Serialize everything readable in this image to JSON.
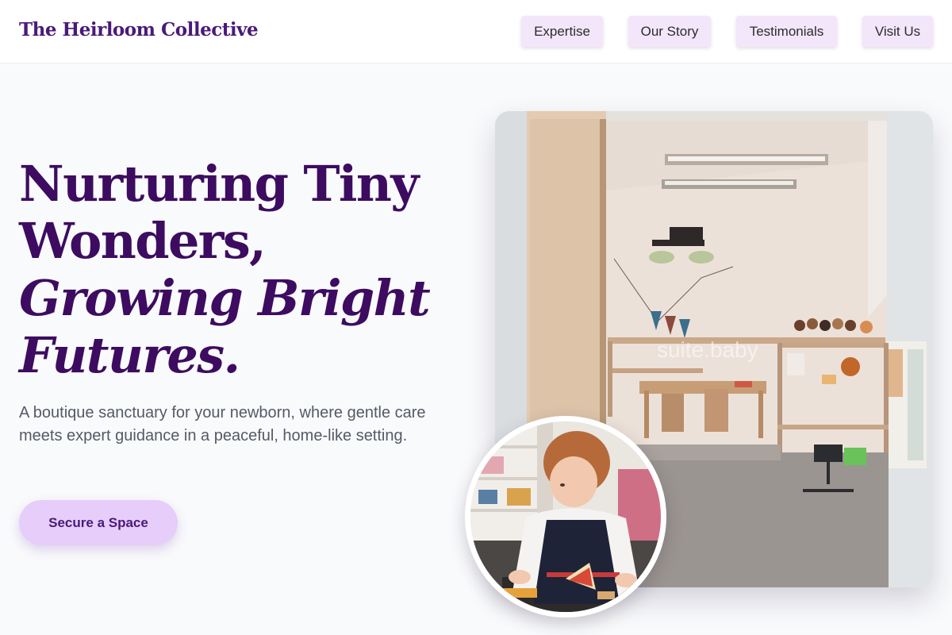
{
  "header": {
    "brand": "The Heirloom Collective",
    "nav": [
      {
        "label": "Expertise"
      },
      {
        "label": "Our Story"
      },
      {
        "label": "Testimonials"
      },
      {
        "label": "Visit Us"
      }
    ]
  },
  "hero": {
    "headline_line1": "Nurturing Tiny",
    "headline_line2": "Wonders,",
    "headline_line3": "Growing Bright",
    "headline_line4": "Futures.",
    "subtext": "A boutique sanctuary for your newborn, where gentle care meets expert guidance in a peaceful, home-like setting.",
    "cta_label": "Secure a Space"
  },
  "images": {
    "main_photo": "nursery-playroom-photo",
    "inset_photo": "toddler-playing-photo",
    "watermark": "suite.baby"
  },
  "colors": {
    "brand_purple": "#4a1a78",
    "headline_purple": "#3d0c60",
    "nav_button_bg": "#f3e6fa",
    "cta_bg": "#e7cdfa",
    "page_bg": "#f9fafc"
  }
}
